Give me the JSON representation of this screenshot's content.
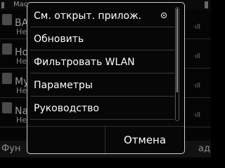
{
  "status_bar": {
    "title": "Мас"
  },
  "background_list": [
    {
      "name": "BA",
      "sub": "Не",
      "signal": "·ıll"
    },
    {
      "name": "Но",
      "sub": "Не",
      "signal": "·ıll"
    },
    {
      "name": "My",
      "sub": "Не",
      "signal": "·ıll"
    },
    {
      "name": "Na",
      "sub": "Не",
      "signal": "·ıll"
    }
  ],
  "background_softkeys": {
    "left": "Фун",
    "right": "ад"
  },
  "popup_menu": {
    "items": [
      {
        "label": "См. открыт. прилож.",
        "selected": true
      },
      {
        "label": "Обновить"
      },
      {
        "label": "Фильтровать WLAN"
      },
      {
        "label": "Параметры"
      },
      {
        "label": "Руководство"
      }
    ],
    "scroll_position": 0.0,
    "left_softkey": "",
    "right_softkey": "Отмена"
  },
  "colors": {
    "background": "#050505",
    "popup_border": "#d0d0d0",
    "text": "#ffffff",
    "dim_text": "#9a9a9a"
  },
  "icons": {
    "radio": "radio-selected-icon",
    "signal": "wlan-signal-icon"
  }
}
